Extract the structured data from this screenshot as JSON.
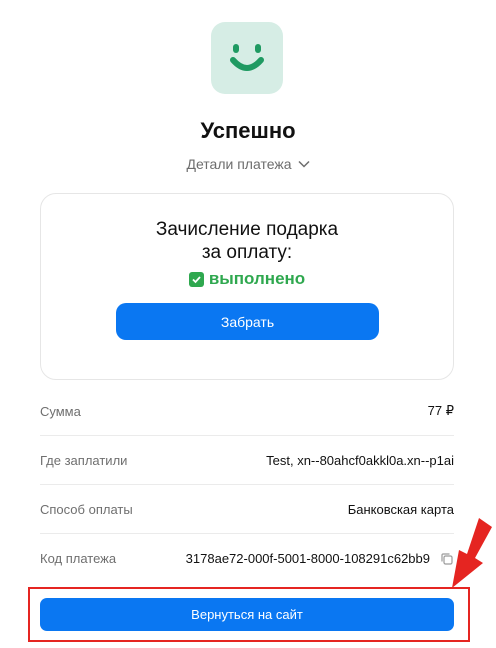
{
  "header": {
    "logo_icon": "smile-icon",
    "logo_bg": "#d6ede5",
    "logo_fg": "#1f9a62",
    "title": "Успешно",
    "details_label": "Детали платежа",
    "details_icon": "chevron-down-icon"
  },
  "gift_card": {
    "title_line1": "Зачисление подарка",
    "title_line2": "за оплату:",
    "status_icon": "check-icon",
    "status_text": "выполнено",
    "status_color": "#2fa84f",
    "button_label": "Забрать"
  },
  "details": {
    "rows": [
      {
        "label": "Сумма",
        "value": "77 ₽"
      },
      {
        "label": "Где заплатили",
        "value": "Test, xn--80ahcf0akkl0a.xn--p1ai"
      },
      {
        "label": "Способ оплаты",
        "value": "Банковская карта"
      },
      {
        "label": "Код платежа",
        "value": "3178ae72-000f-5001-8000-108291c62bb9"
      }
    ],
    "copy_icon": "copy-icon"
  },
  "footer": {
    "return_button_label": "Вернуться на сайт",
    "accent_color": "#0a77f2",
    "annotation_color": "#e52521",
    "annotation_icon": "arrow-icon"
  }
}
